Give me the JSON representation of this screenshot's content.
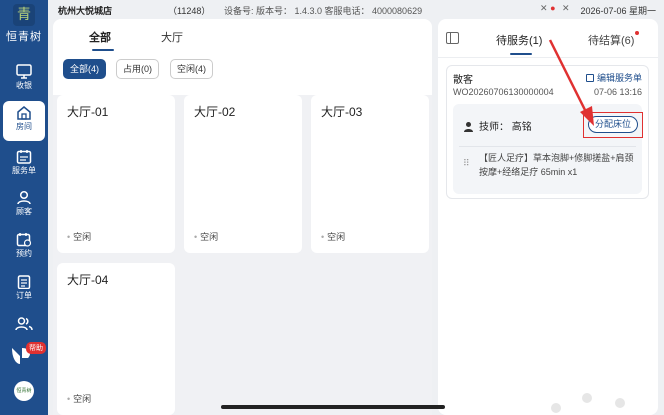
{
  "brand": {
    "logo_char": "青",
    "name": "恒青树"
  },
  "sidebar": {
    "items": [
      {
        "label": "收银",
        "icon": "monitor-icon"
      },
      {
        "label": "房间",
        "icon": "home-icon",
        "active": true
      },
      {
        "label": "服务单",
        "icon": "calendar-list-icon"
      },
      {
        "label": "顾客",
        "icon": "user-icon"
      },
      {
        "label": "预约",
        "icon": "calendar-clock-icon"
      },
      {
        "label": "订单",
        "icon": "clipboard-icon"
      },
      {
        "label": "",
        "icon": "users-icon"
      }
    ],
    "help_badge": "帮助",
    "avatar_text": "恒青树"
  },
  "status_bar": {
    "store": "杭州大悦城店",
    "store_code": "（11248）",
    "device_info": "设备号:  版本号： 1.4.3.0  客服电话： 4000080629",
    "datetime": "2026-07-06 星期一"
  },
  "main": {
    "tabs": [
      "全部",
      "大厅"
    ],
    "active_tab": "全部",
    "filters": [
      {
        "label": "全部(4)",
        "active": true
      },
      {
        "label": "占用(0)",
        "active": false
      },
      {
        "label": "空闲(4)",
        "active": false
      }
    ],
    "rooms": [
      {
        "name": "大厅-01",
        "state": "空闲"
      },
      {
        "name": "大厅-02",
        "state": "空闲"
      },
      {
        "name": "大厅-03",
        "state": "空闲"
      },
      {
        "name": "大厅-04",
        "state": "空闲"
      }
    ]
  },
  "right_panel": {
    "tab_pending": "待服务(1)",
    "tab_settle": "待结算(6)",
    "order": {
      "type": "散客",
      "edit_label": "编辑服务单",
      "number": "WO20260706130000004",
      "time": "07-06 13:16",
      "technician": "技师：  高铭",
      "assign_button": "分配床位",
      "service": "【匠人足疗】草本泡脚+修脚搓盐+肩颈按摩+经络足疗 65min x1"
    }
  },
  "colors": {
    "primary": "#1f4e8c",
    "highlight": "#e03131"
  }
}
